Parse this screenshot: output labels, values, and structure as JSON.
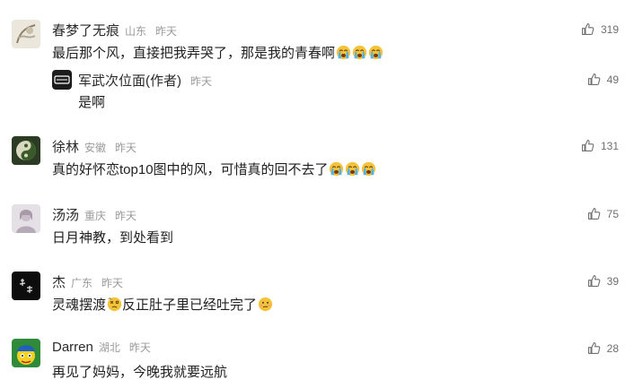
{
  "comments": [
    {
      "name": "春梦了无痕",
      "region": "山东",
      "time": "昨天",
      "text": "最后那个风，直接把我弄哭了，那是我的青春啊",
      "emoji_suffix": [
        "crying-face",
        "crying-face",
        "crying-face"
      ],
      "likes": "319",
      "reply": {
        "name": "军武次位面(作者)",
        "time": "昨天",
        "text": "是啊",
        "likes": "49"
      }
    },
    {
      "name": "徐林",
      "region": "安徽",
      "time": "昨天",
      "text": "真的好怀恋top10图中的风，可惜真的回不去了",
      "emoji_suffix": [
        "crying-face",
        "crying-face",
        "crying-face"
      ],
      "likes": "131"
    },
    {
      "name": "汤汤",
      "region": "重庆",
      "time": "昨天",
      "text": "日月神教，到处看到",
      "likes": "75"
    },
    {
      "name": "杰",
      "region": "广东",
      "time": "昨天",
      "text_part1": "灵魂摆渡",
      "text_part2": "反正肚子里已经吐完了",
      "likes": "39"
    },
    {
      "name": "Darren",
      "region": "湖北",
      "time": "昨天",
      "text": "再见了妈妈，今晚我就要远航",
      "likes": "28"
    }
  ],
  "icons": {
    "like": "thumbs-up-icon"
  }
}
